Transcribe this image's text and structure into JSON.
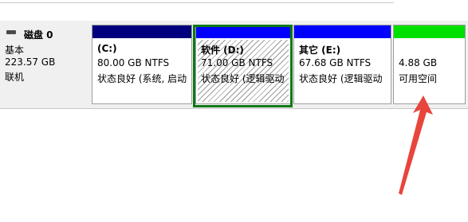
{
  "disk": {
    "title": "磁盘 0",
    "type": "基本",
    "size": "223.57 GB",
    "status": "联机"
  },
  "partitions": [
    {
      "label": "(C:)",
      "size": "80.00 GB NTFS",
      "status": "状态良好 (系统, 启动",
      "bar_color": "#00007f"
    },
    {
      "label": "软件  (D:)",
      "size": "71.00 GB NTFS",
      "status": "状态良好 (逻辑驱动",
      "bar_color": "#0000ff"
    },
    {
      "label": "其它  (E:)",
      "size": "67.68 GB NTFS",
      "status": "状态良好 (逻辑驱动",
      "bar_color": "#0000ff"
    },
    {
      "label": "",
      "size": "4.88 GB",
      "status": "可用空间",
      "bar_color": "#00e000"
    }
  ],
  "colors": {
    "selection_frame": "#0b7a16",
    "annotation_arrow": "#e8453c"
  }
}
